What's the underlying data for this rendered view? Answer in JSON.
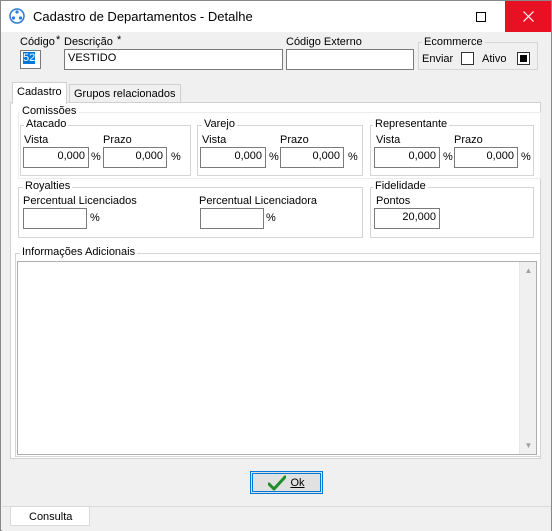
{
  "window": {
    "title": "Cadastro de Departamentos - Detalhe"
  },
  "header": {
    "codigo_label": "Código",
    "codigo_required": "*",
    "codigo_value": "52",
    "descricao_label": "Descrição",
    "descricao_required": "*",
    "descricao_value": "VESTIDO",
    "codigo_externo_label": "Código Externo",
    "codigo_externo_value": "",
    "ecommerce": {
      "group_label": "Ecommerce",
      "enviar_label": "Enviar",
      "enviar_checked": false,
      "ativo_label": "Ativo",
      "ativo_checked": true
    }
  },
  "tabs": [
    {
      "label": "Cadastro",
      "active": true
    },
    {
      "label": "Grupos relacionados",
      "active": false
    }
  ],
  "comissoes": {
    "group_label": "Comissões",
    "atacado": {
      "label": "Atacado",
      "vista_label": "Vista",
      "vista_value": "0,000",
      "prazo_label": "Prazo",
      "prazo_value": "0,000"
    },
    "varejo": {
      "label": "Varejo",
      "vista_label": "Vista",
      "vista_value": "0,000",
      "prazo_label": "Prazo",
      "prazo_value": "0,000"
    },
    "representante": {
      "label": "Representante",
      "vista_label": "Vista",
      "vista_value": "0,000",
      "prazo_label": "Prazo",
      "prazo_value": "0,000"
    },
    "percent_symbol": "%"
  },
  "royalties": {
    "group_label": "Royalties",
    "licenciados_label": "Percentual Licenciados",
    "licenciados_value": "",
    "licenciadora_label": "Percentual Licenciadora",
    "licenciadora_value": "",
    "percent_symbol": "%"
  },
  "fidelidade": {
    "group_label": "Fidelidade",
    "pontos_label": "Pontos",
    "pontos_value": "20,000"
  },
  "informacoes": {
    "group_label": "Informações Adicionais",
    "value": ""
  },
  "footer": {
    "ok_label": "Ok"
  },
  "statusbar": {
    "tab_label": "Consulta"
  },
  "colors": {
    "accent": "#0078d7",
    "close": "#e81123",
    "ok_check": "#1f8c2a"
  }
}
